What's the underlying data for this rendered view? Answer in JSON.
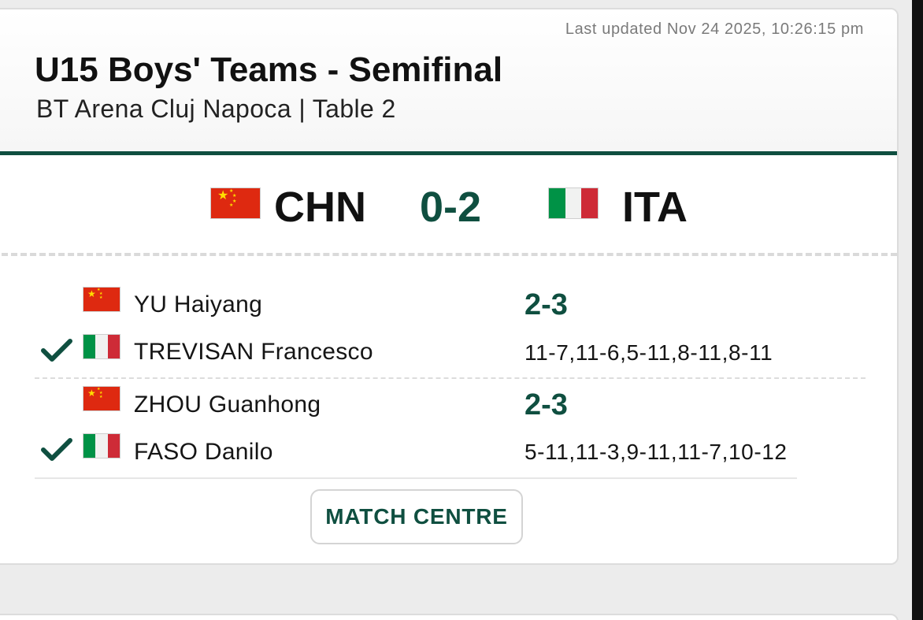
{
  "last_updated": "Last updated Nov 24 2025, 10:26:15 pm",
  "title": "U15 Boys' Teams - Semifinal",
  "subtitle": "BT Arena Cluj Napoca | Table 2",
  "home_team": {
    "code": "CHN",
    "flag": "china-flag-icon"
  },
  "away_team": {
    "code": "ITA",
    "flag": "italy-flag-icon"
  },
  "team_score": "0-2",
  "rubbers": [
    {
      "score": "2-3",
      "games": "11-7,11-6,5-11,8-11,8-11",
      "home_player": {
        "name": "YU Haiyang",
        "winner": false
      },
      "away_player": {
        "name": "TREVISAN Francesco",
        "winner": true
      }
    },
    {
      "score": "2-3",
      "games": "5-11,11-3,9-11,11-7,10-12",
      "home_player": {
        "name": "ZHOU Guanhong",
        "winner": false
      },
      "away_player": {
        "name": "FASO Danilo",
        "winner": true
      }
    }
  ],
  "match_centre_label": "MATCH CENTRE",
  "colors": {
    "accent": "#0f4f40",
    "china_red": "#de2910",
    "italy_green": "#009246",
    "italy_red": "#ce2b37"
  }
}
